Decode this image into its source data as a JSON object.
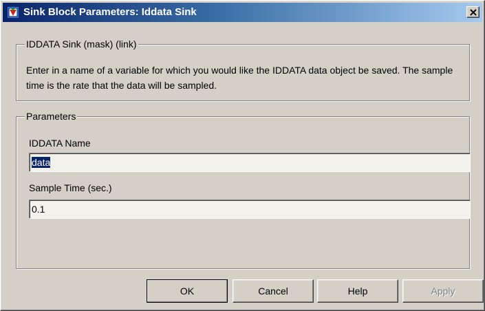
{
  "window": {
    "title": "Sink Block Parameters: Iddata Sink",
    "title_icon": "simulink-block-icon",
    "close_glyph": "✕"
  },
  "description_group": {
    "legend": "IDDATA Sink (mask) (link)",
    "text": "Enter in a name of a variable for which you would like the IDDATA data object be saved.  The sample time is the rate that the data will be sampled."
  },
  "parameters_group": {
    "legend": "Parameters",
    "fields": [
      {
        "label": "IDDATA Name",
        "value": "data",
        "selected": true
      },
      {
        "label": "Sample Time (sec.)",
        "value": "0.1",
        "selected": false
      }
    ]
  },
  "buttons": {
    "ok": "OK",
    "cancel": "Cancel",
    "help": "Help",
    "apply": "Apply"
  },
  "colors": {
    "titlebar_start": "#0a246a",
    "titlebar_end": "#a6caf0",
    "dialog_face": "#d4d0c8",
    "selection": "#0a246a"
  }
}
